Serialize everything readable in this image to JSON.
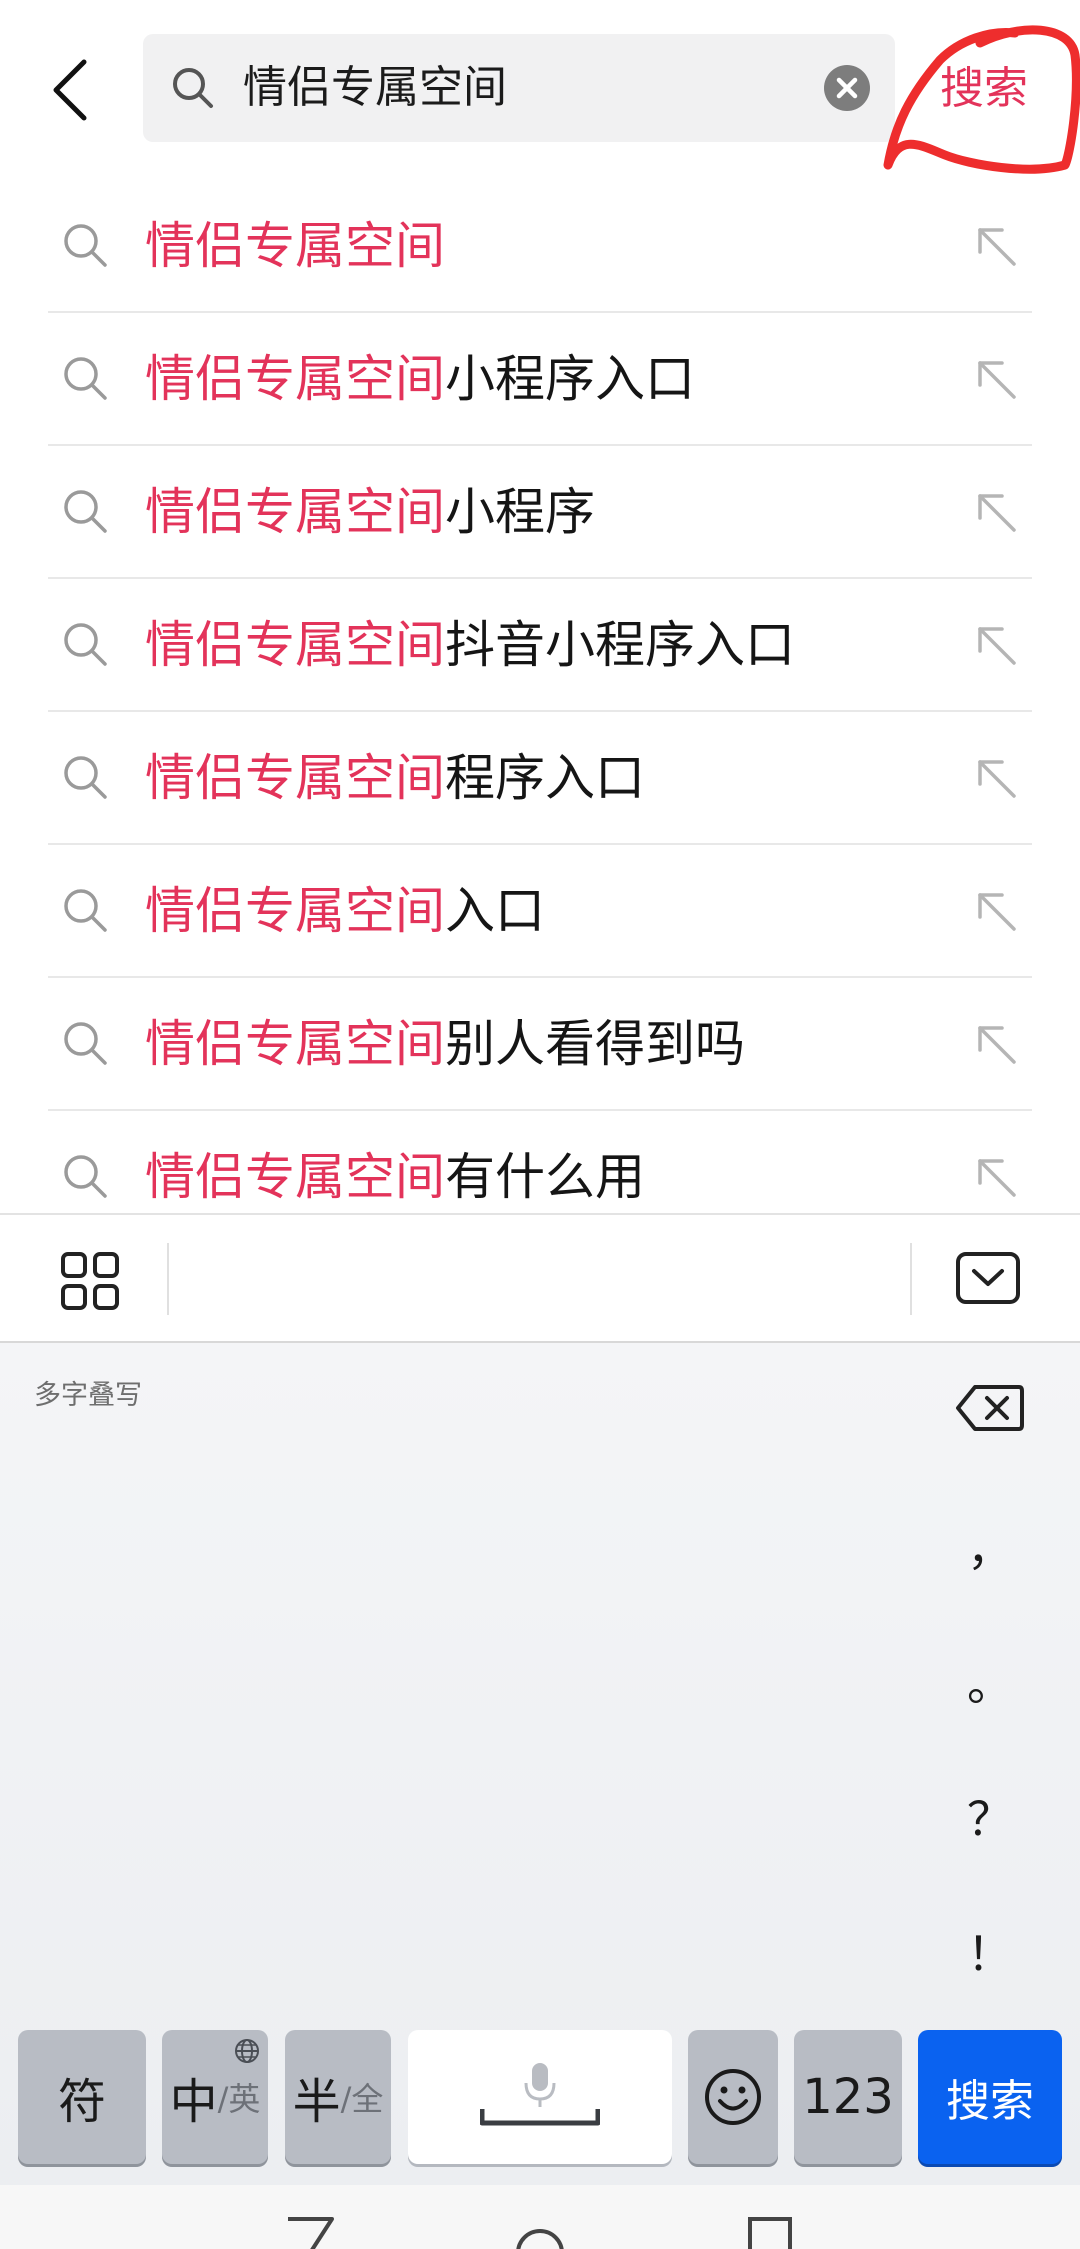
{
  "header": {
    "query": "情侣专属空间",
    "search_label": "搜索"
  },
  "suggestions": [
    {
      "highlight": "情侣专属空间",
      "rest": ""
    },
    {
      "highlight": "情侣专属空间",
      "rest": "小程序入口"
    },
    {
      "highlight": "情侣专属空间",
      "rest": "小程序"
    },
    {
      "highlight": "情侣专属空间",
      "rest": "抖音小程序入口"
    },
    {
      "highlight": "情侣专属空间",
      "rest": "程序入口"
    },
    {
      "highlight": "情侣专属空间",
      "rest": "入口"
    },
    {
      "highlight": "情侣专属空间",
      "rest": "别人看得到吗"
    },
    {
      "highlight": "情侣专属空间",
      "rest": "有什么用"
    }
  ],
  "keyboard": {
    "mode_label": "多字叠写",
    "punctuation": [
      "，",
      "。",
      "？",
      "！"
    ],
    "keys": {
      "symbol": "符",
      "lang_main": "中",
      "lang_alt": "/英",
      "width_main": "半",
      "width_alt": "/全",
      "numbers": "123",
      "search": "搜索"
    }
  },
  "colors": {
    "accent": "#e3335a",
    "primary_key": "#0a62f0"
  }
}
